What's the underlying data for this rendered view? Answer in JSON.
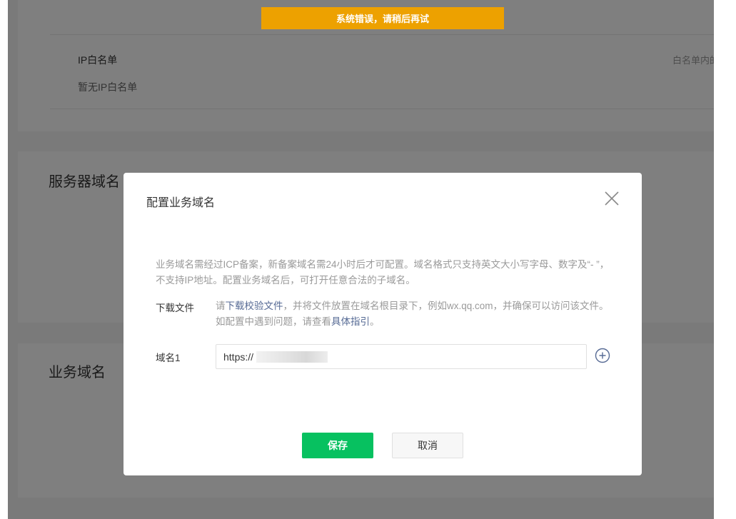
{
  "toast": {
    "message": "系统错误，请稍后再试"
  },
  "background": {
    "ip_whitelist": {
      "title": "IP白名单",
      "right_hint": "白名单内的I",
      "empty_text": "暂无IP白名单"
    },
    "server_domain_title": "服务器域名",
    "business_domain_title": "业务域名"
  },
  "dialog": {
    "title": "配置业务域名",
    "close_icon": "close-icon",
    "description": "业务域名需经过ICP备案，新备案域名需24小时后才可配置。域名格式只支持英文大小写字母、数字及“- ”，不支持IP地址。配置业务域名后，可打开任意合法的子域名。",
    "download": {
      "label": "下载文件",
      "text_prefix": "请",
      "link_verify_file": "下载校验文件",
      "text_middle": "，并将文件放置在域名根目录下，例如wx.qq.com，并确保可以访问该文件。如配置中遇到问题，请查看",
      "link_guide": "具体指引",
      "text_suffix": "。"
    },
    "domain_field": {
      "label": "域名1",
      "value": "https://"
    },
    "add_icon": "plus-circle-icon",
    "save_label": "保存",
    "cancel_label": "取消"
  }
}
